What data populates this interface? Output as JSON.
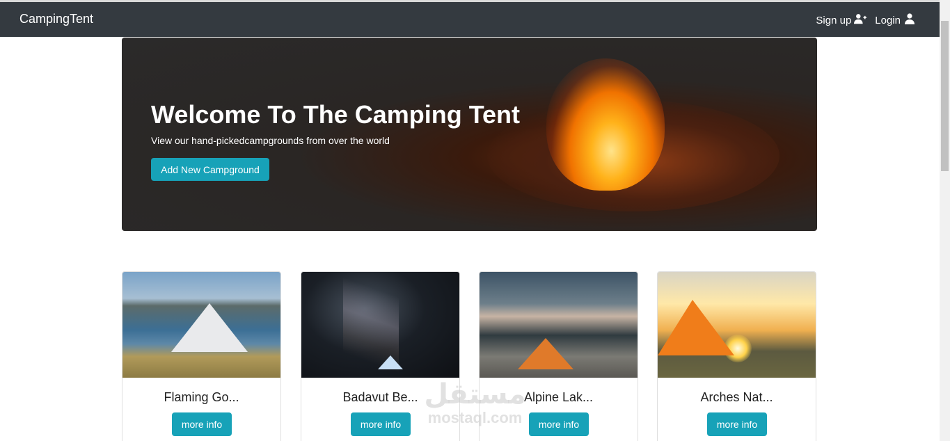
{
  "navbar": {
    "brand": "CampingTent",
    "signup_label": "Sign up",
    "login_label": "Login"
  },
  "hero": {
    "title": "Welcome To The Camping Tent",
    "subtitle": "View our hand-pickedcampgrounds from over the world",
    "button_label": "Add New Campground"
  },
  "cards": [
    {
      "title": "Flaming Go...",
      "button_label": "more info"
    },
    {
      "title": "Badavut Be...",
      "button_label": "more info"
    },
    {
      "title": "Alpine Lak...",
      "button_label": "more info"
    },
    {
      "title": "Arches Nat...",
      "button_label": "more info"
    }
  ],
  "watermark": {
    "arabic": "مستقل",
    "latin": "mostaql.com"
  },
  "colors": {
    "navbar": "#343a40",
    "accent": "#17a2b8"
  }
}
